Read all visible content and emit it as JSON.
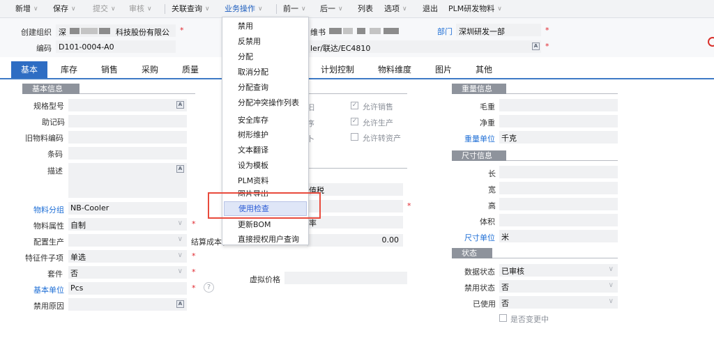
{
  "toolbar": {
    "items": [
      "新增",
      "保存",
      "提交",
      "审核",
      "关联查询",
      "业务操作",
      "前一",
      "后一",
      "列表",
      "选项",
      "退出",
      "PLM研发物料"
    ]
  },
  "header": {
    "org_label": "创建组织",
    "org_value_prefix": "深",
    "org_value_suffix": "科技股份有限公",
    "code_label": "编码",
    "code_value": "D101-0004-A0",
    "name_partial": "维书",
    "name_value_suffix": "ler/联达/EC4810",
    "dept_label": "部门",
    "dept_value": "深圳研发一部",
    "icon_text": "A"
  },
  "tabs": [
    "基本",
    "库存",
    "销售",
    "采购",
    "质量",
    "计划控制",
    "物料维度",
    "图片",
    "其他"
  ],
  "basic": {
    "section_title": "基本信息",
    "labels": {
      "spec": "规格型号",
      "mnemonic": "助记码",
      "old_code": "旧物料编码",
      "barcode": "条码",
      "desc": "描述",
      "group": "物料分组",
      "attr": "物料属性",
      "config": "配置生产",
      "feature": "特征件子项",
      "kit": "套件",
      "unit": "基本单位",
      "disable_reason": "禁用原因"
    },
    "values": {
      "group": "NB-Cooler",
      "attr": "自制",
      "feature": "单选",
      "kit": "否",
      "unit": "Pcs"
    },
    "help": "?"
  },
  "middle": {
    "checkboxes": [
      {
        "label": "允许销售",
        "checked": true
      },
      {
        "label": "允许生产",
        "checked": true
      },
      {
        "label": "允许转资产",
        "checked": false
      }
    ],
    "partial_labels": [
      "汩",
      "序",
      "卜"
    ],
    "tax_partial": "值税",
    "rate_partial": "率",
    "cost_label_partial": "结算成本(",
    "cost_value": "0.00",
    "virtual_price_label": "虚拟价格"
  },
  "weight": {
    "section_title": "重量信息",
    "gross": "毛重",
    "net": "净重",
    "unit_label": "重量单位",
    "unit_value": "千克"
  },
  "size": {
    "section_title": "尺寸信息",
    "length": "长",
    "width": "宽",
    "height": "高",
    "volume": "体积",
    "unit_label": "尺寸单位",
    "unit_value": "米"
  },
  "status": {
    "section_title": "状态",
    "data_status_label": "数据状态",
    "data_status_value": "已审核",
    "disable_status_label": "禁用状态",
    "disable_status_value": "否",
    "used_label": "已使用",
    "used_value": "否",
    "changing_label": "是否变更中"
  },
  "menu": {
    "items": [
      "禁用",
      "反禁用",
      "分配",
      "取消分配",
      "分配查询",
      "分配冲突操作列表",
      "安全库存",
      "树形维护",
      "文本翻译",
      "设为模板",
      "PLM资料",
      "图片导出",
      "使用检查",
      "更新BOM",
      "直接授权用户查询"
    ],
    "highlighted": "使用检查"
  },
  "colors": {
    "accent": "#2e6dc3",
    "required": "#e0262d",
    "highlight_box": "#e84a3c"
  }
}
